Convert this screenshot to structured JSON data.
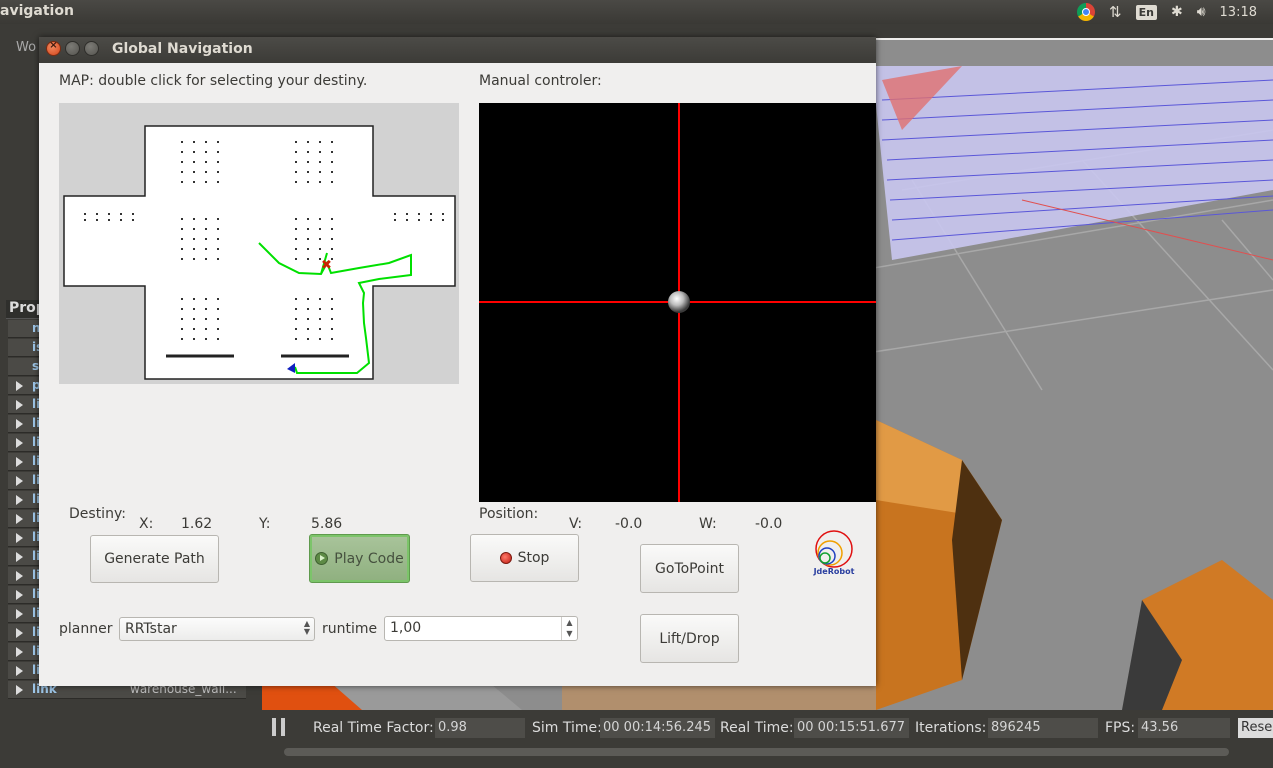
{
  "topbar": {
    "app_title": "avigation",
    "lang": "En",
    "time": "13:18"
  },
  "gazebo": {
    "world_tab": "Wo",
    "props_header": "Prop",
    "prop_rows": [
      {
        "name": "n",
        "value": "",
        "expandable": false
      },
      {
        "name": "is",
        "value": "",
        "expandable": false
      },
      {
        "name": "s",
        "value": "",
        "expandable": false
      },
      {
        "name": "p",
        "value": "",
        "expandable": true
      },
      {
        "name": "li",
        "value": "",
        "expandable": true
      },
      {
        "name": "li",
        "value": "",
        "expandable": true
      },
      {
        "name": "li",
        "value": "",
        "expandable": true
      },
      {
        "name": "li",
        "value": "",
        "expandable": true
      },
      {
        "name": "li",
        "value": "",
        "expandable": true
      },
      {
        "name": "li",
        "value": "",
        "expandable": true
      },
      {
        "name": "li",
        "value": "",
        "expandable": true
      },
      {
        "name": "li",
        "value": "",
        "expandable": true
      },
      {
        "name": "li",
        "value": "",
        "expandable": true
      },
      {
        "name": "li",
        "value": "",
        "expandable": true
      },
      {
        "name": "li",
        "value": "",
        "expandable": true
      },
      {
        "name": "li",
        "value": "",
        "expandable": true
      },
      {
        "name": "li",
        "value": "",
        "expandable": true
      },
      {
        "name": "li",
        "value": "",
        "expandable": true
      },
      {
        "name": "link",
        "value": "warehouse_wall...",
        "expandable": true
      },
      {
        "name": "link",
        "value": "warehouse_wall...",
        "expandable": true
      }
    ],
    "stats": {
      "rtf_label": "Real Time Factor:",
      "rtf": "0.98",
      "sim_label": "Sim Time:",
      "sim": "00 00:14:56.245",
      "real_label": "Real Time:",
      "real": "00 00:15:51.677",
      "iter_label": "Iterations:",
      "iter": "896245",
      "fps_label": "FPS:",
      "fps": "43.56",
      "reset": "Rese"
    }
  },
  "dialog": {
    "title": "Global Navigation",
    "map_label": "MAP: double click for selecting your destiny.",
    "controller_label": "Manual controler:",
    "destiny_label": "Destiny:",
    "x_label": "X:",
    "x_value": "1.62",
    "y_label": "Y:",
    "y_value": "5.86",
    "position_label": "Position:",
    "v_label": "V:",
    "v_value": "-0.0",
    "w_label": "W:",
    "w_value": "-0.0",
    "buttons": {
      "generate": "Generate Path",
      "play": "Play Code",
      "stop": "Stop",
      "goto": "GoToPoint",
      "lift": "Lift/Drop"
    },
    "planner_label": "planner",
    "planner_value": "RRTstar",
    "runtime_label": "runtime",
    "runtime_value": "1,00",
    "logo_text": "JdeRobot"
  },
  "colors": {
    "path": "#00e000",
    "crosshair": "#ff0000",
    "accent_orange": "#e95420"
  }
}
